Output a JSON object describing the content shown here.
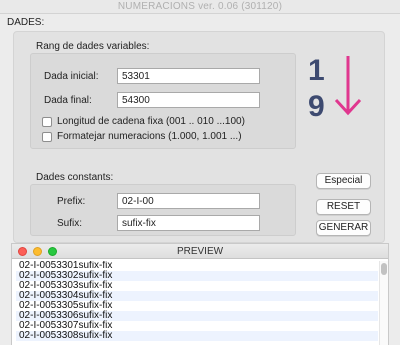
{
  "window": {
    "title": "NUMERACIONS ver. 0.06 (301120)"
  },
  "dades": {
    "label": "DADES:",
    "variables": {
      "label": "Rang de dades variables:",
      "initial_label": "Dada inicial:",
      "initial_value": "53301",
      "final_label": "Dada final:",
      "final_value": "54300",
      "fixed_length_label": "Longitud de cadena fixa (001 .. 010 ...100)",
      "format_label": "Formatejar numeracions (1.000, 1.001 ...)"
    },
    "constants": {
      "label": "Dades constants:",
      "prefix_label": "Prefix:",
      "prefix_value": "02-I-00",
      "suffix_label": "Sufix:",
      "suffix_value": "sufix-fix"
    },
    "logo": {
      "top_digit": "1",
      "bottom_digit": "9",
      "accent": "#e0378f",
      "digit_color": "#3d4a70"
    }
  },
  "buttons": {
    "especial": "Especial",
    "reset": "RESET",
    "generar": "GENERAR"
  },
  "preview": {
    "title": "PREVIEW",
    "rows": [
      "02-I-0053301sufix-fix",
      "02-I-0053302sufix-fix",
      "02-I-0053303sufix-fix",
      "02-I-0053304sufix-fix",
      "02-I-0053305sufix-fix",
      "02-I-0053306sufix-fix",
      "02-I-0053307sufix-fix",
      "02-I-0053308sufix-fix"
    ]
  }
}
